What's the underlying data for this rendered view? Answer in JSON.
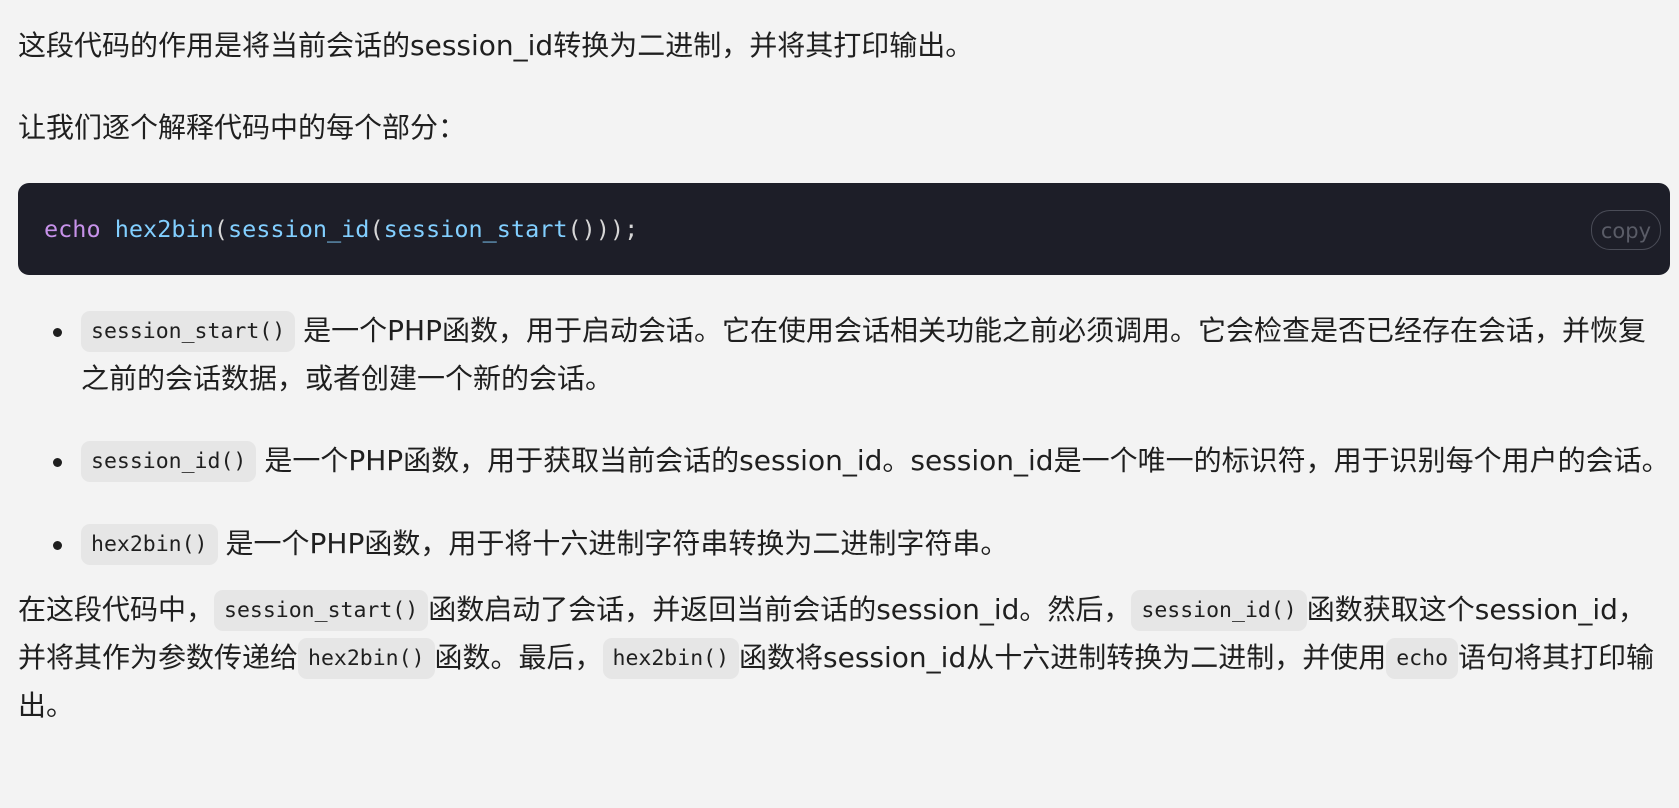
{
  "intro": "这段代码的作用是将当前会话的session_id转换为二进制，并将其打印输出。",
  "lead": "让我们逐个解释代码中的每个部分：",
  "code_block": {
    "keyword": "echo",
    "fn1": "hex2bin",
    "p1": "(",
    "fn2": "session_id",
    "p2": "(",
    "fn3": "session_start",
    "p3": "()));",
    "copy_label": "copy"
  },
  "bullets": [
    {
      "code": "session_start()",
      "text": "是一个PHP函数，用于启动会话。它在使用会话相关功能之前必须调用。它会检查是否已经存在会话，并恢复之前的会话数据，或者创建一个新的会话。"
    },
    {
      "code": "session_id()",
      "text": "是一个PHP函数，用于获取当前会话的session_id。session_id是一个唯一的标识符，用于识别每个用户的会话。"
    },
    {
      "code": "hex2bin()",
      "text": "是一个PHP函数，用于将十六进制字符串转换为二进制字符串。"
    }
  ],
  "summary": {
    "t1": "在这段代码中，",
    "c1": "session_start()",
    "t2": "函数启动了会话，并返回当前会话的session_id。然后，",
    "c2": "session_id()",
    "t3": "函数获取这个session_id，并将其作为参数传递给",
    "c3": "hex2bin()",
    "t4": "函数。最后，",
    "c4": "hex2bin()",
    "t5": "函数将session_id从十六进制转换为二进制，并使用",
    "c5": "echo",
    "t6": "语句将其打印输出。"
  },
  "colors": {
    "page_bg": "#f3f3f3",
    "code_bg": "#1d1e28",
    "keyword": "#c792ea",
    "function": "#82cfff",
    "inline_code_bg": "#e6e6e6"
  }
}
